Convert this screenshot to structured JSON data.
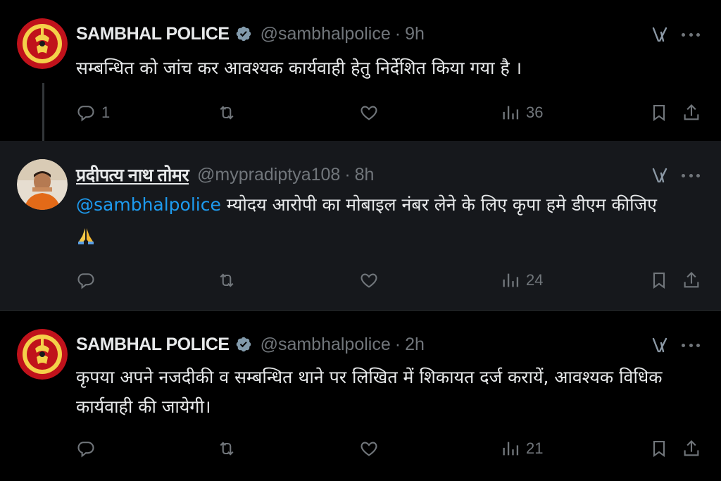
{
  "tweets": [
    {
      "name": "SAMBHAL POLICE",
      "handle": "@sambhalpolice",
      "separator": "·",
      "time": "9h",
      "text": "सम्बन्धित को जांच कर आवश्यक कार्यवाही हेतु निर्देशित किया गया है ।",
      "replies": "1",
      "views": "36",
      "verified": true,
      "avatar": "up-police-emblem"
    },
    {
      "name": "प्रदीपत्य नाथ तोमर",
      "handle": "@mypradiptya108",
      "separator": "·",
      "time": "8h",
      "mention": "@sambhalpolice",
      "text": " म्योदय आरोपी का मोबाइल नंबर लेने के लिए कृपा हमे डीएम कीजिए",
      "emoji": "folded-hands",
      "replies": "",
      "views": "24",
      "verified": false,
      "avatar": "user-photo"
    },
    {
      "name": "SAMBHAL POLICE",
      "handle": "@sambhalpolice",
      "separator": "·",
      "time": "2h",
      "text": "कृपया अपने नजदीकी व सम्बन्धित थाने पर लिखित में शिकायत दर्ज करायें, आवश्यक विधिक कार्यवाही की जायेगी।",
      "replies": "",
      "views": "21",
      "verified": true,
      "avatar": "up-police-emblem"
    }
  ],
  "colors": {
    "background": "#000000",
    "highlight_background": "#16181c",
    "text": "#e7e9ea",
    "muted": "#71767b",
    "link": "#1d9bf0",
    "verified": "#829aab"
  },
  "icons": [
    "reply-icon",
    "retweet-icon",
    "like-icon",
    "views-icon",
    "bookmark-icon",
    "share-icon",
    "grok-icon",
    "more-icon",
    "verified-badge-icon"
  ]
}
